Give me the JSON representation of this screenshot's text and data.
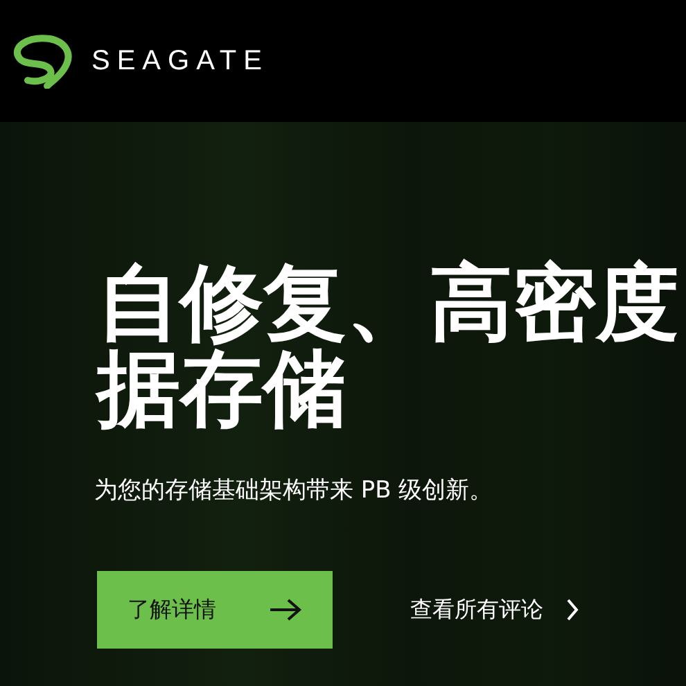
{
  "header": {
    "logo_text": "SEAGATE"
  },
  "hero": {
    "headline_lines": [
      "自修复、高密度",
      "据存储"
    ],
    "subtitle": "为您的存储基础架构带来 PB 级创新。",
    "actions": [
      {
        "kind": "primary",
        "label": "了解详情"
      },
      {
        "kind": "link",
        "label": "查看所有评论"
      }
    ]
  }
}
